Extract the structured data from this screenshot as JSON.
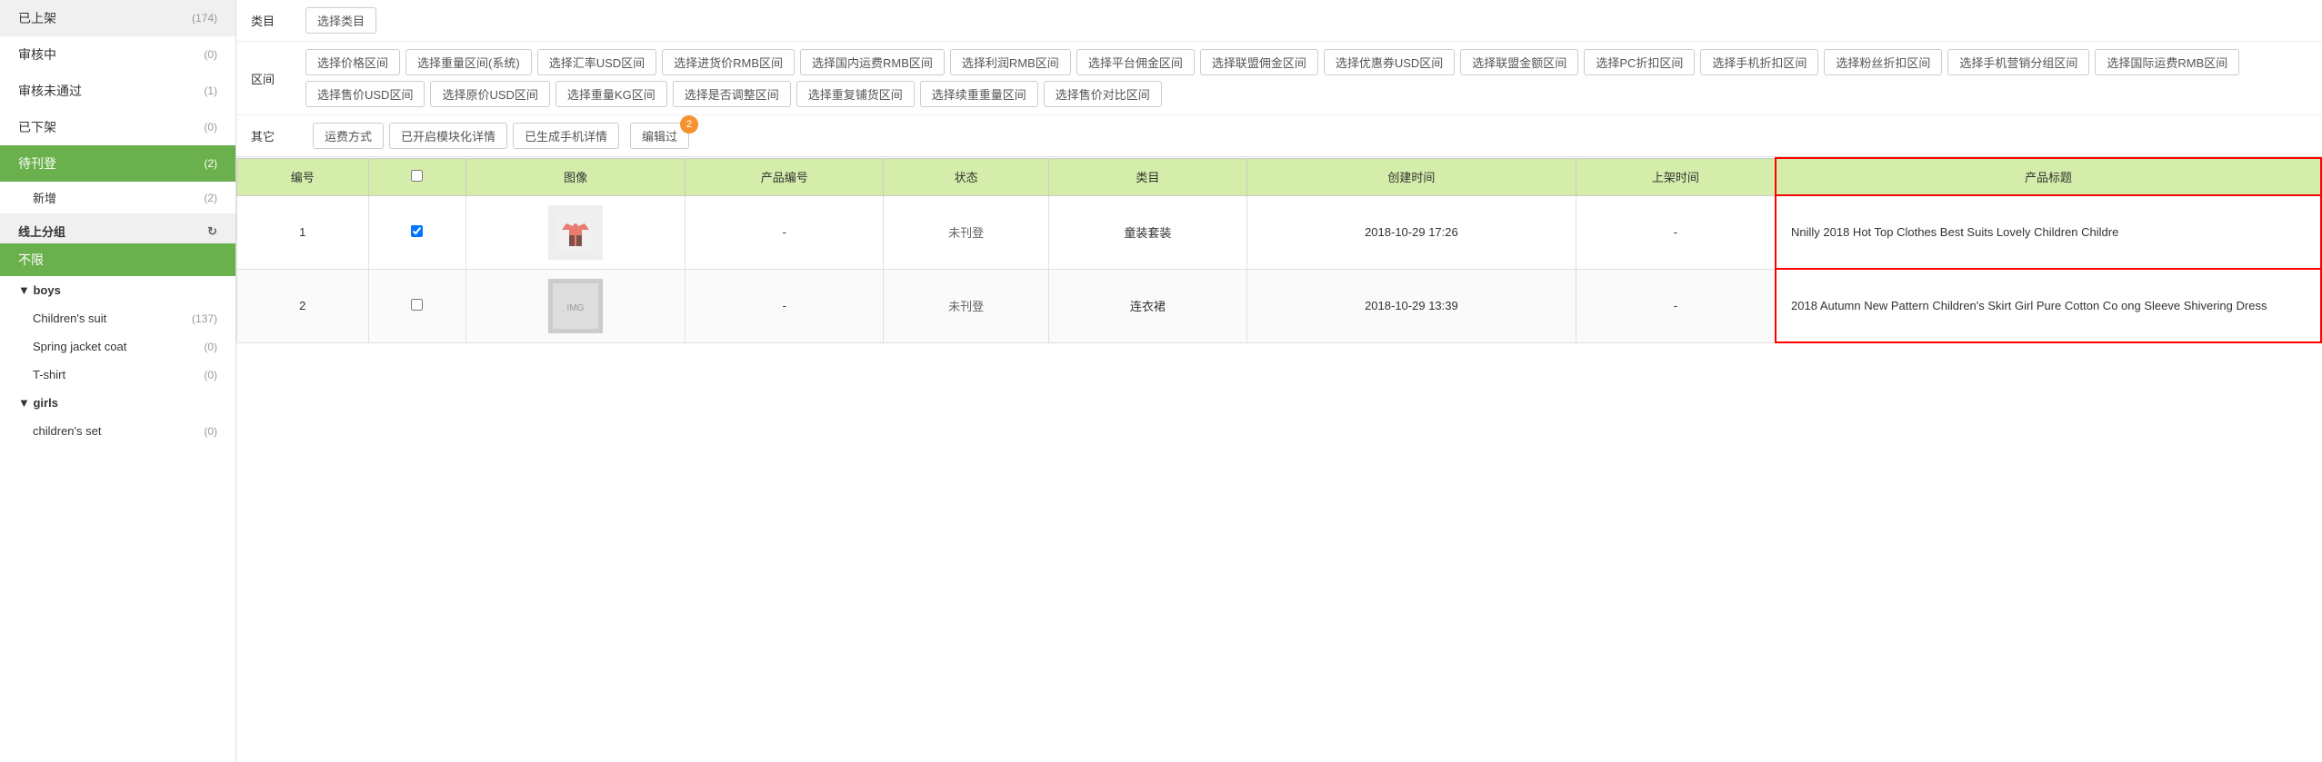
{
  "sidebar": {
    "items": [
      {
        "id": "approved",
        "label": "已上架",
        "count": "(174)",
        "active": false
      },
      {
        "id": "reviewing",
        "label": "审核中",
        "count": "(0)",
        "active": false
      },
      {
        "id": "rejected",
        "label": "审核未通过",
        "count": "(1)",
        "active": false
      },
      {
        "id": "delisted",
        "label": "已下架",
        "count": "(0)",
        "active": false
      },
      {
        "id": "pending",
        "label": "待刊登",
        "count": "(2)",
        "active": true
      }
    ],
    "new_item": {
      "label": "新增",
      "count": "(2)"
    },
    "online_group": {
      "label": "线上分组"
    },
    "unlimited": {
      "label": "不限"
    },
    "boys_group": {
      "label": "▼ boys"
    },
    "boys_children_suit": {
      "label": "Children's suit",
      "count": "(137)"
    },
    "boys_spring_jacket": {
      "label": "Spring jacket coat",
      "count": "(0)"
    },
    "boys_tshirt": {
      "label": "T-shirt",
      "count": "(0)"
    },
    "girls_group": {
      "label": "▼ girls"
    },
    "girls_children_set": {
      "label": "children's set",
      "count": "(0)"
    }
  },
  "filters": {
    "category_label": "类目",
    "category_btn": "选择类目",
    "range_label": "区间",
    "range_buttons": [
      "选择价格区间",
      "选择重量区间(系统)",
      "选择汇率USD区间",
      "选择进货价RMB区间",
      "选择国内运费RMB区间",
      "选择利润RMB区间",
      "选择平台佣金区间",
      "选择联盟佣金区间",
      "选择优惠券USD区间",
      "选择联盟金额区间",
      "选择PC折扣区间",
      "选择手机折扣区间",
      "选择粉丝折扣区间",
      "选择手机营销分组区间",
      "选择国际运费RMB区间",
      "选择售价USD区间",
      "选择原价USD区间",
      "选择重量KG区间",
      "选择是否调整区间",
      "选择重复铺货区间",
      "选择续重重量区间",
      "选择售价对比区间"
    ],
    "other_label": "其它",
    "other_buttons": [
      "运费方式",
      "已开启模块化详情",
      "已生成手机详情"
    ],
    "edit_button": "编辑过",
    "edit_badge": "2"
  },
  "table": {
    "headers": [
      "编号",
      "图像",
      "产品编号",
      "状态",
      "类目",
      "创建时间",
      "上架时间",
      "产品标题"
    ],
    "rows": [
      {
        "id": "1",
        "checked": true,
        "image_type": "clothing",
        "product_no": "-",
        "status": "未刊登",
        "category": "童装套装",
        "created": "2018-10-29 17:26",
        "listed": "-",
        "title": "Nnilly 2018 Hot Top Clothes Best Suits Lovely Children Childre"
      },
      {
        "id": "2",
        "checked": false,
        "image_type": "gray",
        "product_no": "-",
        "status": "未刊登",
        "category": "连衣裙",
        "created": "2018-10-29 13:39",
        "listed": "-",
        "title": "2018 Autumn New Pattern Children's Skirt Girl Pure Cotton Co\nong Sleeve Shivering Dress"
      }
    ]
  },
  "icons": {
    "refresh": "↻"
  }
}
